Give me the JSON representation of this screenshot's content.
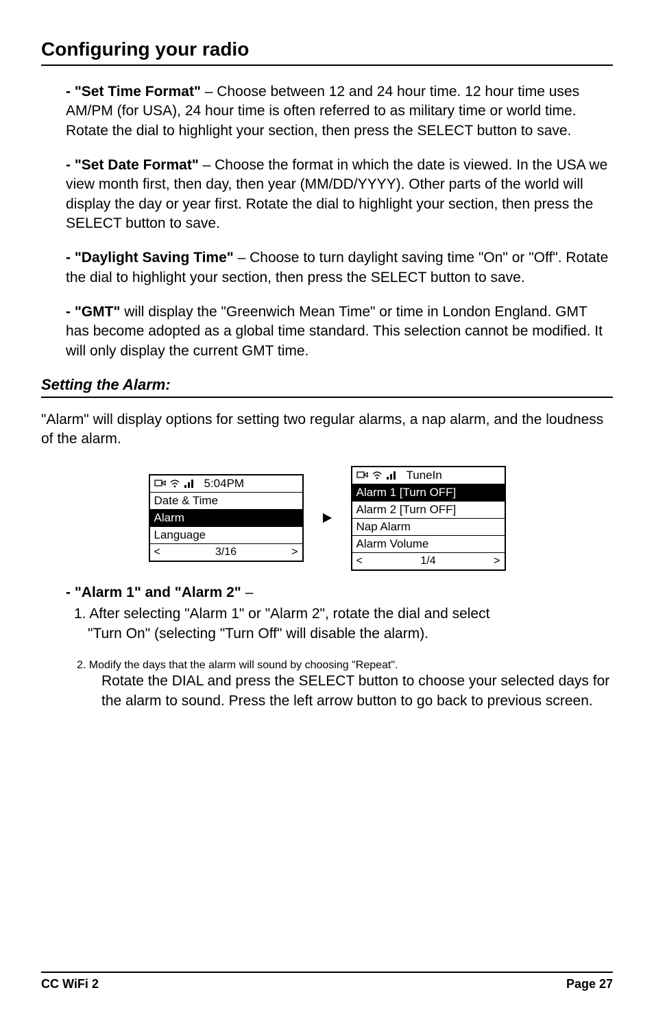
{
  "page_title": "Configuring your radio",
  "items": [
    {
      "label": "- \"Set Time Format\"",
      "text": " – Choose between 12 and 24 hour time. 12 hour time uses AM/PM (for USA), 24 hour time is often referred to as military time or world time. Rotate the dial to highlight your section, then press the SELECT button to save."
    },
    {
      "label": "- \"Set Date Format\"",
      "text": " – Choose the format in which the date is viewed. In the USA we view month first, then day, then year (MM/DD/YYYY). Other parts of the world will display the day or year first. Rotate the dial to highlight your section, then press the SELECT button to save."
    },
    {
      "label": "- \"Daylight Saving Time\"",
      "text": " – Choose to turn daylight saving time \"On\" or \"Off\". Rotate the dial to highlight your section, then press the SELECT button to save."
    },
    {
      "label": "- \"GMT\"",
      "text": " will display the \"Greenwich Mean Time\" or time in London England. GMT has become adopted as a global time standard. This selection cannot be modified. It will only display the current GMT time."
    }
  ],
  "subhead": "Setting the Alarm:",
  "alarm_lead": "\"Alarm\" will display options for setting two regular alarms, a nap alarm, and the loudness of the alarm.",
  "screen1": {
    "status": "5:04PM",
    "rows": [
      "Date & Time",
      "Alarm",
      "Language"
    ],
    "highlight_index": 1,
    "pager_left": "<",
    "pager_center": "3/16",
    "pager_right": ">"
  },
  "screen2": {
    "status": "TuneIn",
    "rows": [
      "Alarm 1 [Turn OFF]",
      "Alarm 2 [Turn OFF]",
      "Nap Alarm",
      "Alarm Volume"
    ],
    "highlight_index": 0,
    "pager_left": "<",
    "pager_center": "1/4",
    "pager_right": ">"
  },
  "alarm_section": {
    "label": "- \"Alarm 1\" and \"Alarm 2\"",
    "dash": " –",
    "step1_a": "1. After selecting \"Alarm 1\" or \"Alarm 2\", rotate the dial and select",
    "step1_b": "\"Turn On\" (selecting \"Turn Off\" will disable the alarm).",
    "step2_a": "2. Modify the days that the alarm will sound by choosing \"Repeat\".",
    "step2_b": "Rotate the DIAL and press the SELECT button to choose your selected days for the alarm to sound. Press the left arrow button to go back to previous screen."
  },
  "footer_left": "CC WiFi 2",
  "footer_right": "Page 27"
}
